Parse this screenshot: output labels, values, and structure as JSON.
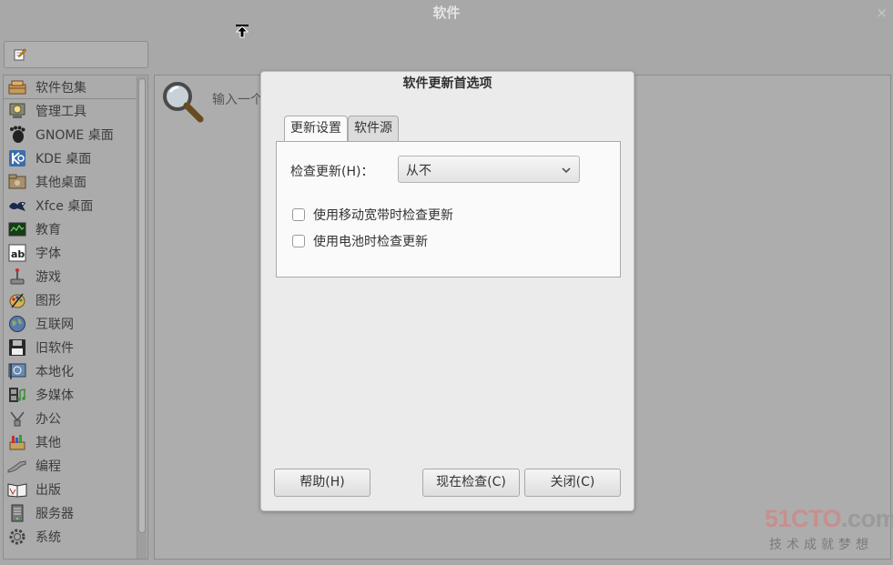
{
  "window": {
    "title": "软件",
    "close_glyph": "×"
  },
  "search": {
    "hint": "输入一个"
  },
  "sidebar": {
    "items": [
      {
        "label": "软件包集",
        "icon": "package-collection-icon"
      },
      {
        "label": "管理工具",
        "icon": "admin-tools-icon"
      },
      {
        "label": "GNOME 桌面",
        "icon": "gnome-icon"
      },
      {
        "label": "KDE 桌面",
        "icon": "kde-icon"
      },
      {
        "label": "其他桌面",
        "icon": "other-desktops-icon"
      },
      {
        "label": "Xfce 桌面",
        "icon": "xfce-icon"
      },
      {
        "label": "教育",
        "icon": "education-icon"
      },
      {
        "label": "字体",
        "icon": "fonts-icon"
      },
      {
        "label": "游戏",
        "icon": "games-icon"
      },
      {
        "label": "图形",
        "icon": "graphics-icon"
      },
      {
        "label": "互联网",
        "icon": "internet-icon"
      },
      {
        "label": "旧软件",
        "icon": "legacy-icon"
      },
      {
        "label": "本地化",
        "icon": "localization-icon"
      },
      {
        "label": "多媒体",
        "icon": "multimedia-icon"
      },
      {
        "label": "办公",
        "icon": "office-icon"
      },
      {
        "label": "其他",
        "icon": "other-icon"
      },
      {
        "label": "编程",
        "icon": "programming-icon"
      },
      {
        "label": "出版",
        "icon": "publishing-icon"
      },
      {
        "label": "服务器",
        "icon": "servers-icon"
      },
      {
        "label": "系统",
        "icon": "system-icon"
      }
    ]
  },
  "dialog": {
    "title": "软件更新首选项",
    "tabs": [
      {
        "label": "更新设置",
        "active": true
      },
      {
        "label": "软件源",
        "active": false
      }
    ],
    "check_label": "检查更新(H)：",
    "check_value": "从不",
    "checkboxes": [
      {
        "label": "使用移动宽带时检查更新",
        "checked": false
      },
      {
        "label": "使用电池时检查更新",
        "checked": false
      }
    ],
    "buttons": {
      "help": "帮助(H)",
      "check_now": "现在检查(C)",
      "close": "关闭(C)"
    }
  },
  "watermark": {
    "logo_red": "51CTO",
    "logo_gray": ".com",
    "tagline": "技术成就梦想"
  },
  "colors": {
    "accent": "#c68f8f",
    "dialog_bg": "#ebebeb",
    "backdrop": "#a8a8a8"
  }
}
